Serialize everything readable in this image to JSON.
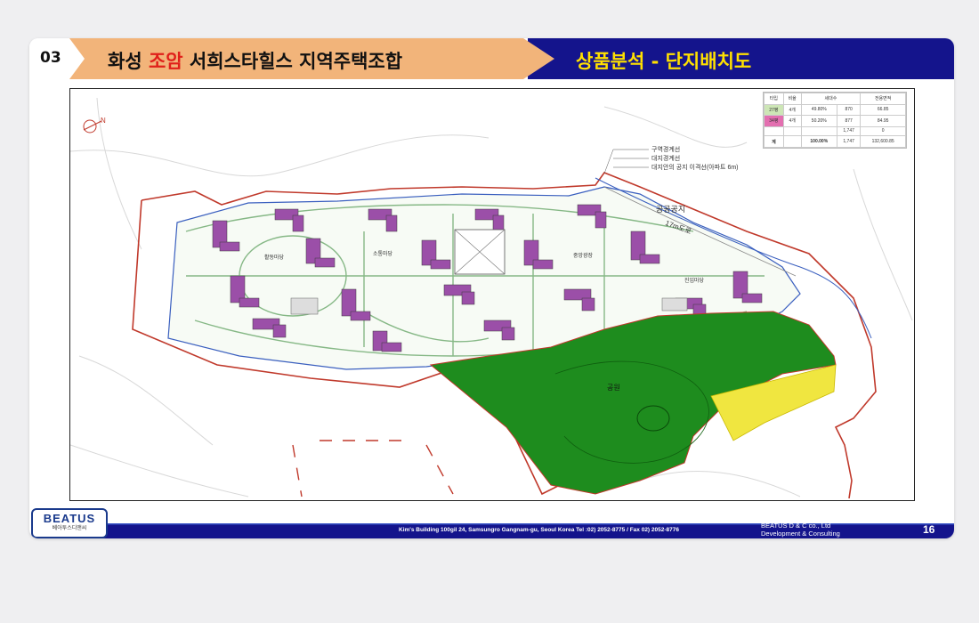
{
  "header": {
    "section_number": "03",
    "title_part1": "화성",
    "title_highlight": "조암",
    "title_part2": "서희스타힐스 지역주택조합",
    "right_title": "상품분석 - 단지배치도"
  },
  "plan": {
    "boundary_legend": [
      "구역경계선",
      "대지경계선",
      "대지안의 공지 이격선(아파트 6m)"
    ],
    "labels": {
      "public_land": "공공공지",
      "road": "17m도로",
      "park": "공원",
      "zone1": "활동마당",
      "zone2": "소통마당",
      "zone3": "진입마당",
      "zone4": "중앙광장"
    },
    "legend_table": {
      "headers": [
        "타입",
        "비율",
        "세대수",
        "전용면적"
      ],
      "rows": [
        [
          "27평",
          "4개",
          "49.80%",
          "870",
          "66.85"
        ],
        [
          "34평",
          "4개",
          "50.20%",
          "877",
          "84.95"
        ],
        [
          "",
          "",
          "",
          "1,747",
          "0"
        ],
        [
          "계",
          "",
          "100.00%",
          "1,747",
          "132,600.85"
        ]
      ]
    }
  },
  "footer": {
    "address": "Kim's Building 100gil 24, Samsungro Gangnam-gu, Seoul Korea    Tel :02) 2052-8775 /  Fax 02) 2052-8776",
    "company_line1": "BEATUS D & C co., Ltd",
    "company_line2": "Development & Consulting",
    "page_number": "16",
    "logo_text": "BEATUS",
    "logo_sub": "베아투스디앤씨"
  },
  "colors": {
    "header_orange": "#f2b47a",
    "header_navy": "#14148c",
    "title_yellow": "#ffe000",
    "accent_red": "#e0201a",
    "park_green": "#1e8c1e",
    "yellow_zone": "#f0e640",
    "building_purple": "#9b4fa8"
  }
}
